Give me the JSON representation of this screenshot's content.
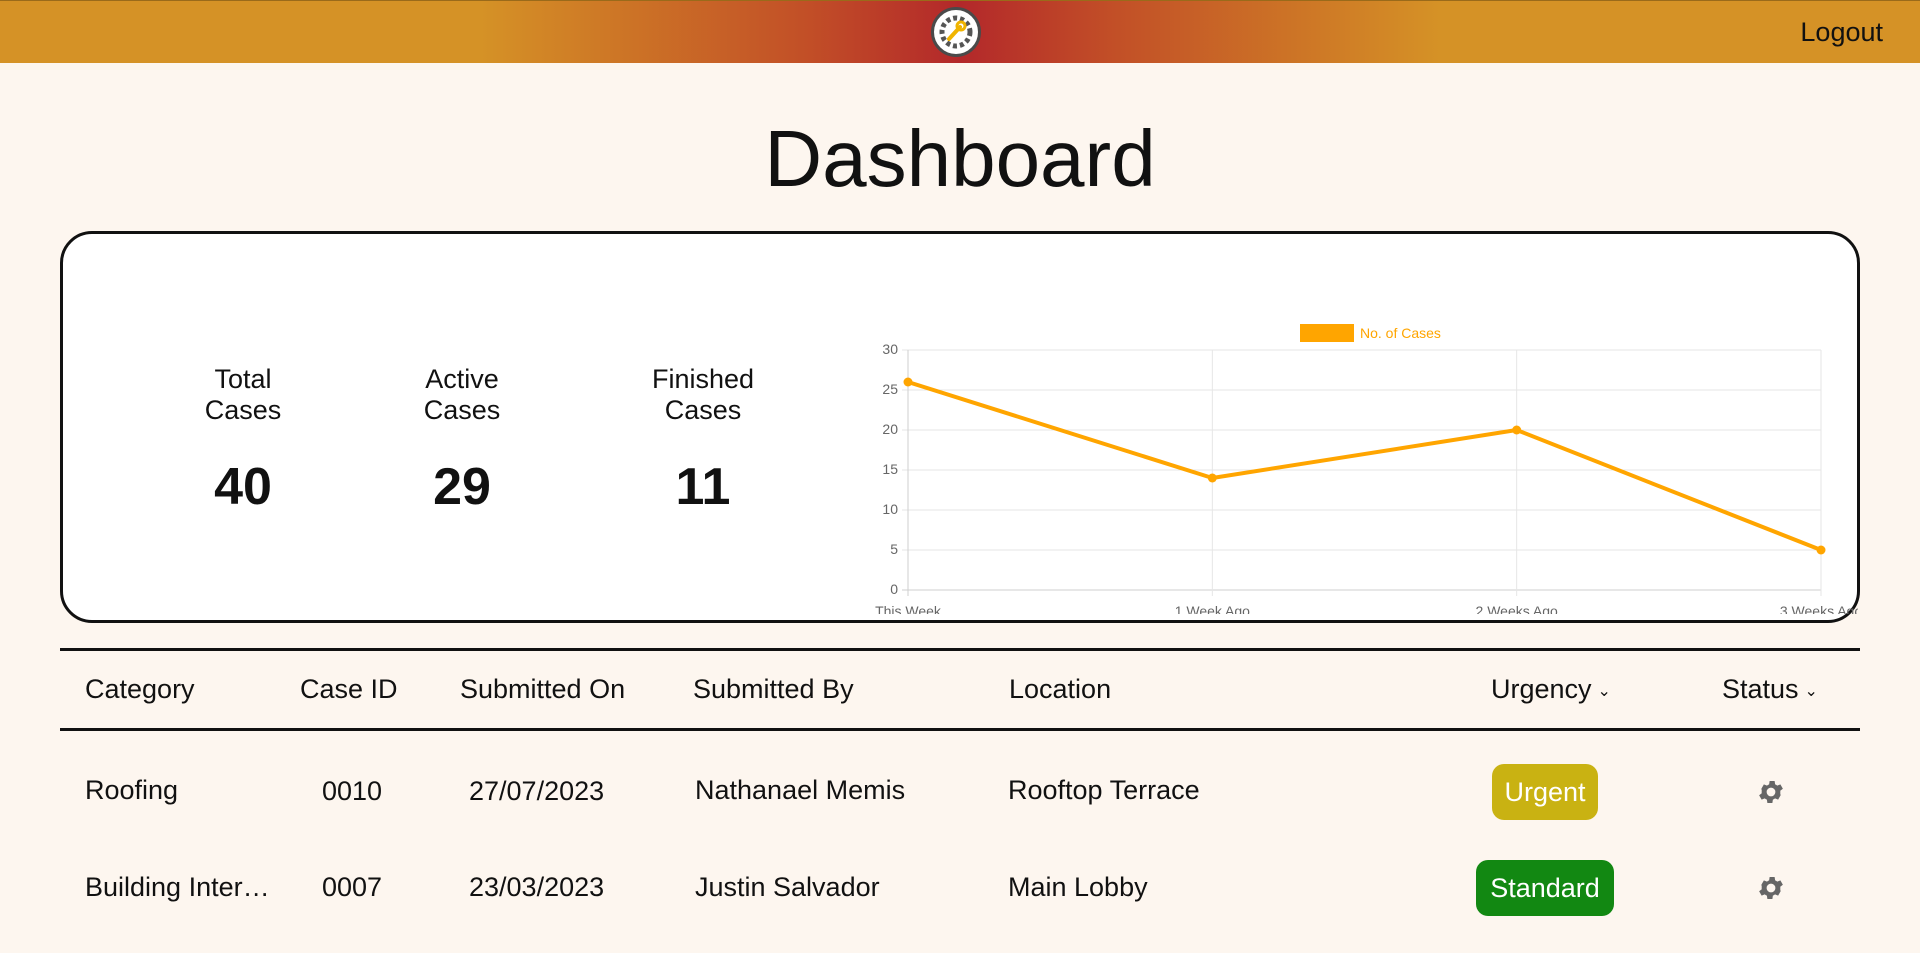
{
  "header": {
    "logo_icon": "gear-wrench-logo",
    "logout_label": "Logout"
  },
  "page": {
    "title": "Dashboard"
  },
  "stats": [
    {
      "label_line1": "Total",
      "label_line2": "Cases",
      "value": "40"
    },
    {
      "label_line1": "Active",
      "label_line2": "Cases",
      "value": "29"
    },
    {
      "label_line1": "Finished",
      "label_line2": "Cases",
      "value": "11"
    }
  ],
  "chart_data": {
    "type": "line",
    "categories": [
      "This Week",
      "1 Week Ago",
      "2 Weeks Ago",
      "3 Weeks Ago"
    ],
    "series": [
      {
        "name": "No. of Cases",
        "values": [
          26,
          14,
          20,
          5
        ],
        "color": "#ffa500"
      }
    ],
    "ylim": [
      0,
      30
    ],
    "yticks": [
      "0",
      "5",
      "10",
      "15",
      "20",
      "25",
      "30"
    ],
    "grid": true,
    "legend": "top"
  },
  "table": {
    "columns": [
      "Category",
      "Case ID",
      "Submitted On",
      "Submitted By",
      "Location",
      "Urgency",
      "Status"
    ],
    "rows": [
      {
        "category": "Roofing",
        "case_id": "0010",
        "submitted_on": "27/07/2023",
        "submitted_by": "Nathanael Memis",
        "location": "Rooftop Terrace",
        "urgency": "Urgent",
        "urgency_color": "#c9b212",
        "status_icon": "gear-icon"
      },
      {
        "category": "Building Inter…",
        "case_id": "0007",
        "submitted_on": "23/03/2023",
        "submitted_by": "Justin Salvador",
        "location": "Main Lobby",
        "urgency": "Standard",
        "urgency_color": "#128812",
        "status_icon": "gear-icon"
      }
    ]
  }
}
